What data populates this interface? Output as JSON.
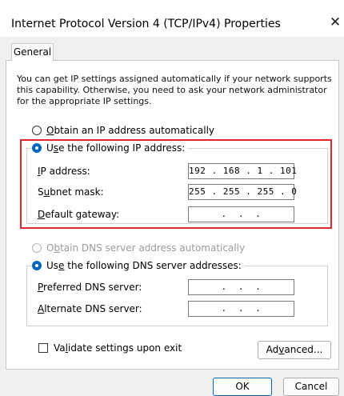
{
  "window": {
    "title": "Internet Protocol Version 4 (TCP/IPv4) Properties",
    "close_glyph": "✕"
  },
  "tabs": [
    {
      "label": "General"
    }
  ],
  "description": "You can get IP settings assigned automatically if your network supports this capability. Otherwise, you need to ask your network administrator for the appropriate IP settings.",
  "ip": {
    "auto_prefix": "",
    "auto_key": "O",
    "auto_rest": "btain an IP address automatically",
    "manual_prefix": "U",
    "manual_key": "s",
    "manual_rest": "e the following IP address:",
    "ip_label_key": "I",
    "ip_label_rest": "P address:",
    "ip_value": "192 . 168 . 1 . 101",
    "mask_label_pre": "S",
    "mask_label_key": "u",
    "mask_label_rest": "bnet mask:",
    "mask_value": "255 . 255 . 255 . 0",
    "gw_label_key": "D",
    "gw_label_rest": "efault gateway:",
    "gw_value": " .  .  . "
  },
  "dns": {
    "auto_pre": "O",
    "auto_key": "b",
    "auto_rest": "tain DNS server address automatically",
    "manual_pre": "Us",
    "manual_key": "e",
    "manual_rest": " the following DNS server addresses:",
    "pref_key": "P",
    "pref_rest": "referred DNS server:",
    "pref_value": " .  .  . ",
    "alt_key": "A",
    "alt_rest": "lternate DNS server:",
    "alt_value": " .  .  . "
  },
  "validate": {
    "pre": "Va",
    "key": "l",
    "rest": "idate settings upon exit"
  },
  "buttons": {
    "advanced_pre": "Ad",
    "advanced_key": "v",
    "advanced_rest": "anced...",
    "ok": "OK",
    "cancel": "Cancel"
  },
  "colors": {
    "accent": "#0067c0",
    "highlight": "#e0262c"
  }
}
